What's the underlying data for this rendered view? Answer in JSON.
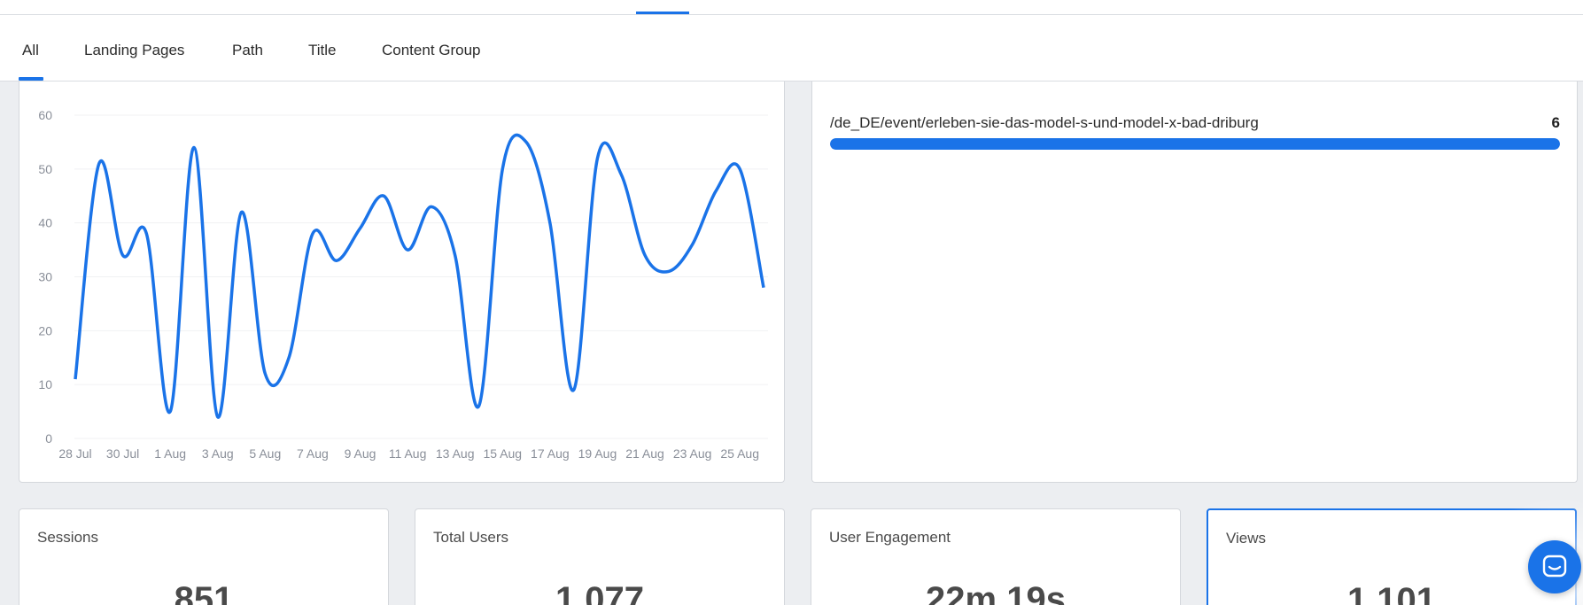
{
  "tabs": [
    {
      "label": "All",
      "active": true
    },
    {
      "label": "Landing Pages",
      "active": false
    },
    {
      "label": "Path",
      "active": false
    },
    {
      "label": "Title",
      "active": false
    },
    {
      "label": "Content Group",
      "active": false
    }
  ],
  "chart_data": {
    "type": "line",
    "title": "",
    "xlabel": "",
    "ylabel": "",
    "ylim": [
      0,
      60
    ],
    "yticks": [
      0,
      10,
      20,
      30,
      40,
      50,
      60
    ],
    "x_tick_labels": [
      "28 Jul",
      "30 Jul",
      "1 Aug",
      "3 Aug",
      "5 Aug",
      "7 Aug",
      "9 Aug",
      "11 Aug",
      "13 Aug",
      "15 Aug",
      "17 Aug",
      "19 Aug",
      "21 Aug",
      "23 Aug",
      "25 Aug"
    ],
    "x": [
      "28 Jul",
      "29 Jul",
      "30 Jul",
      "31 Jul",
      "1 Aug",
      "2 Aug",
      "3 Aug",
      "4 Aug",
      "5 Aug",
      "6 Aug",
      "7 Aug",
      "8 Aug",
      "9 Aug",
      "10 Aug",
      "11 Aug",
      "12 Aug",
      "13 Aug",
      "14 Aug",
      "15 Aug",
      "16 Aug",
      "17 Aug",
      "18 Aug",
      "19 Aug",
      "20 Aug",
      "21 Aug",
      "22 Aug",
      "23 Aug",
      "24 Aug",
      "25 Aug",
      "26 Aug"
    ],
    "series": [
      {
        "values": [
          11,
          51,
          34,
          38,
          5,
          54,
          4,
          42,
          12,
          15,
          38,
          33,
          39,
          45,
          35,
          43,
          34,
          6,
          50,
          55,
          40,
          9,
          52,
          49,
          34,
          31,
          36,
          46,
          50,
          28
        ]
      }
    ],
    "color": "#1a73e8",
    "grid": true
  },
  "top_pages": [
    {
      "path": "/de_DE/event/erleben-sie-das-model-s-und-model-x-bad-driburg",
      "value": "6",
      "fraction": 1.0
    }
  ],
  "metrics": [
    {
      "label": "Sessions",
      "value": "851"
    },
    {
      "label": "Total Users",
      "value": "1,077"
    },
    {
      "label": "User Engagement",
      "value": "22m 19s"
    },
    {
      "label": "Views",
      "value": "1,101",
      "selected": true
    }
  ],
  "colors": {
    "accent": "#1a73e8",
    "background": "#eceef1"
  },
  "icons": {
    "chat": "chat-bubble-icon"
  }
}
